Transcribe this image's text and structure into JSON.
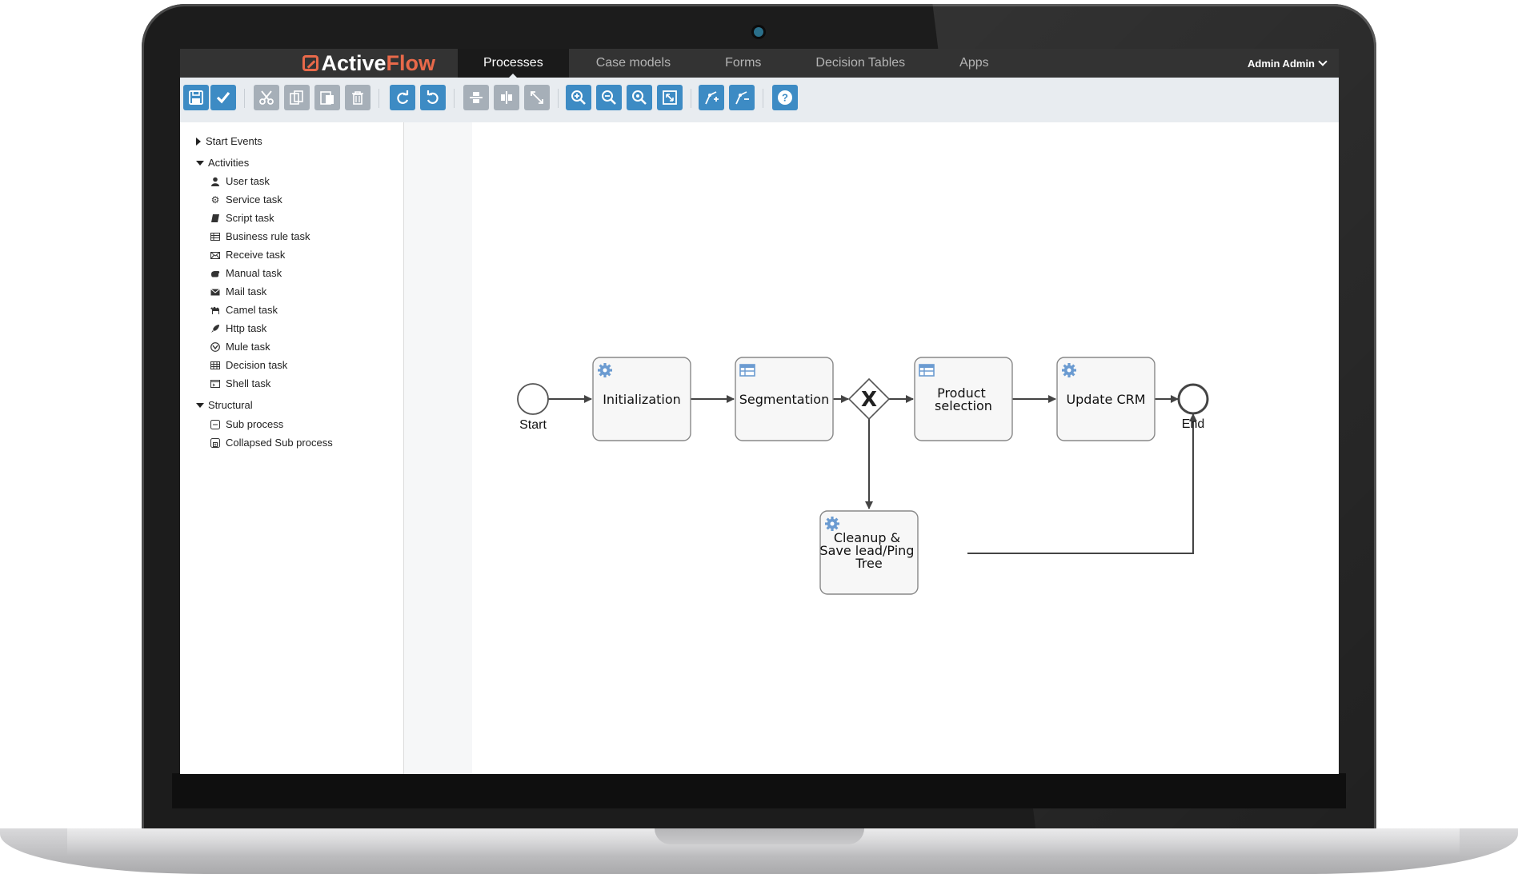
{
  "app": {
    "logo_text_main": "Active",
    "logo_text_accent": "Flow",
    "brand_accent_color": "#e8694a",
    "user_menu_label": "Admin Admin"
  },
  "nav": {
    "tabs": [
      {
        "label": "Processes",
        "active": true
      },
      {
        "label": "Case models",
        "active": false
      },
      {
        "label": "Forms",
        "active": false
      },
      {
        "label": "Decision Tables",
        "active": false
      },
      {
        "label": "Apps",
        "active": false
      }
    ]
  },
  "toolbar": {
    "buttons": [
      {
        "icon": "save-icon",
        "style": "blue"
      },
      {
        "icon": "validate-icon",
        "style": "blue"
      },
      {
        "icon": "cut-icon",
        "style": "gray"
      },
      {
        "icon": "copy-icon",
        "style": "gray"
      },
      {
        "icon": "paste-icon",
        "style": "gray"
      },
      {
        "icon": "delete-icon",
        "style": "gray"
      },
      {
        "icon": "redo-icon",
        "style": "blue"
      },
      {
        "icon": "undo-icon",
        "style": "blue"
      },
      {
        "icon": "align-vertical-icon",
        "style": "gray"
      },
      {
        "icon": "align-horizontal-icon",
        "style": "gray"
      },
      {
        "icon": "same-size-icon",
        "style": "gray"
      },
      {
        "icon": "zoom-in-icon",
        "style": "blue"
      },
      {
        "icon": "zoom-out-icon",
        "style": "blue"
      },
      {
        "icon": "zoom-actual-icon",
        "style": "blue"
      },
      {
        "icon": "zoom-fit-icon",
        "style": "blue"
      },
      {
        "icon": "add-bendpoint-icon",
        "style": "blue"
      },
      {
        "icon": "remove-bendpoint-icon",
        "style": "blue"
      },
      {
        "icon": "help-icon",
        "style": "blue"
      }
    ]
  },
  "palette": {
    "start_events": "Start Events",
    "activities": "Activities",
    "structural": "Structural",
    "activity_items": [
      {
        "label": "User task",
        "icon": "user-icon"
      },
      {
        "label": "Service task",
        "icon": "gear-icon"
      },
      {
        "label": "Script task",
        "icon": "script-icon"
      },
      {
        "label": "Business rule task",
        "icon": "table-icon"
      },
      {
        "label": "Receive task",
        "icon": "envelope-open-icon"
      },
      {
        "label": "Manual task",
        "icon": "hand-icon"
      },
      {
        "label": "Mail task",
        "icon": "envelope-icon"
      },
      {
        "label": "Camel task",
        "icon": "camel-icon"
      },
      {
        "label": "Http task",
        "icon": "rocket-icon"
      },
      {
        "label": "Mule task",
        "icon": "mule-icon"
      },
      {
        "label": "Decision task",
        "icon": "grid-icon"
      },
      {
        "label": "Shell task",
        "icon": "terminal-icon"
      }
    ],
    "structural_items": [
      {
        "label": "Sub process",
        "icon": "subprocess-icon"
      },
      {
        "label": "Collapsed Sub process",
        "icon": "collapsed-subprocess-icon"
      }
    ]
  },
  "diagram": {
    "start_label": "Start",
    "end_label": "End",
    "gateway_symbol": "X",
    "tasks": {
      "initialization": [
        "Initialization"
      ],
      "segmentation": [
        "Segmentation"
      ],
      "product_selection": [
        "Product",
        "selection"
      ],
      "update_crm": [
        "Update CRM"
      ],
      "cleanup": [
        "Cleanup &",
        "Save lead/Ping",
        "Tree"
      ]
    },
    "task_icon_color": "#6b9bd1"
  }
}
